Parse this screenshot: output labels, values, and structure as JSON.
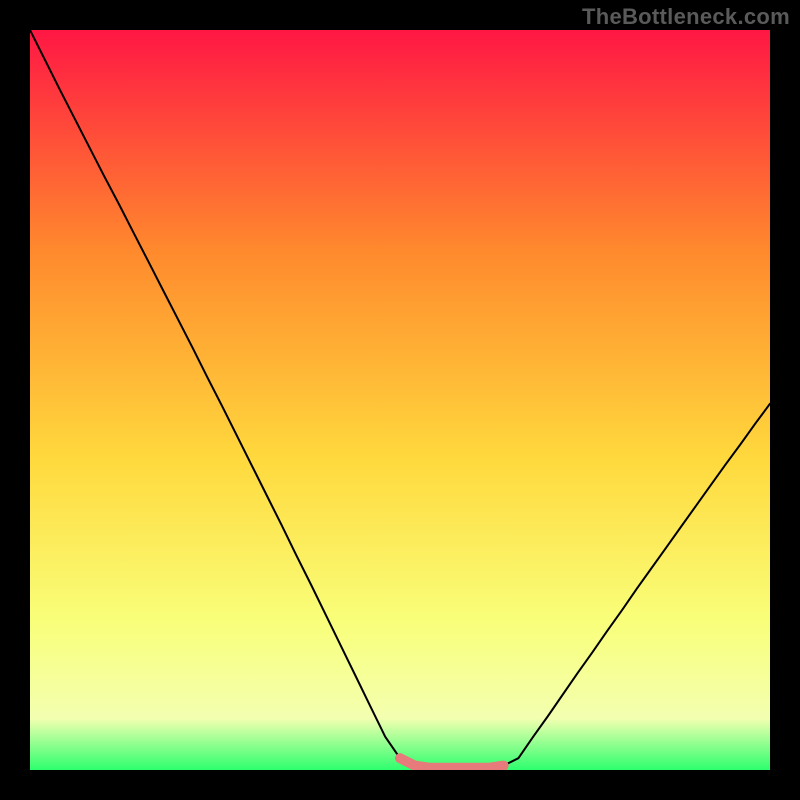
{
  "watermark": "TheBottleneck.com",
  "colors": {
    "bg": "#000000",
    "watermark_text": "#5a5a5a",
    "curve": "#000000",
    "curve_highlight": "#e77a7a",
    "gradient_top": "#ff1744",
    "gradient_mid_top": "#ff8a2d",
    "gradient_mid": "#ffd93d",
    "gradient_low": "#f9ff7a",
    "gradient_band_light": "#f3ffb0",
    "gradient_bottom": "#2dff6e"
  },
  "chart_data": {
    "type": "line",
    "title": "",
    "xlabel": "",
    "ylabel": "",
    "x": [
      0.0,
      0.02,
      0.04,
      0.06,
      0.08,
      0.1,
      0.12,
      0.14,
      0.16,
      0.18,
      0.2,
      0.22,
      0.24,
      0.26,
      0.28,
      0.3,
      0.32,
      0.34,
      0.36,
      0.38,
      0.4,
      0.42,
      0.44,
      0.46,
      0.48,
      0.5,
      0.52,
      0.54,
      0.56,
      0.58,
      0.6,
      0.62,
      0.64,
      0.66,
      0.68,
      0.7,
      0.72,
      0.74,
      0.76,
      0.78,
      0.8,
      0.82,
      0.84,
      0.86,
      0.88,
      0.9,
      0.92,
      0.94,
      0.96,
      0.98,
      1.0
    ],
    "values": [
      1.0,
      0.96,
      0.92,
      0.881,
      0.842,
      0.803,
      0.765,
      0.726,
      0.687,
      0.648,
      0.609,
      0.57,
      0.53,
      0.491,
      0.451,
      0.411,
      0.371,
      0.331,
      0.29,
      0.25,
      0.209,
      0.168,
      0.127,
      0.086,
      0.045,
      0.016,
      0.006,
      0.003,
      0.003,
      0.003,
      0.003,
      0.003,
      0.006,
      0.016,
      0.045,
      0.073,
      0.102,
      0.131,
      0.159,
      0.188,
      0.216,
      0.245,
      0.273,
      0.301,
      0.329,
      0.357,
      0.385,
      0.413,
      0.44,
      0.468,
      0.495
    ],
    "xlim": [
      0,
      1
    ],
    "ylim": [
      0,
      1
    ],
    "highlight_x_range": [
      0.5,
      0.64
    ],
    "annotations": []
  }
}
